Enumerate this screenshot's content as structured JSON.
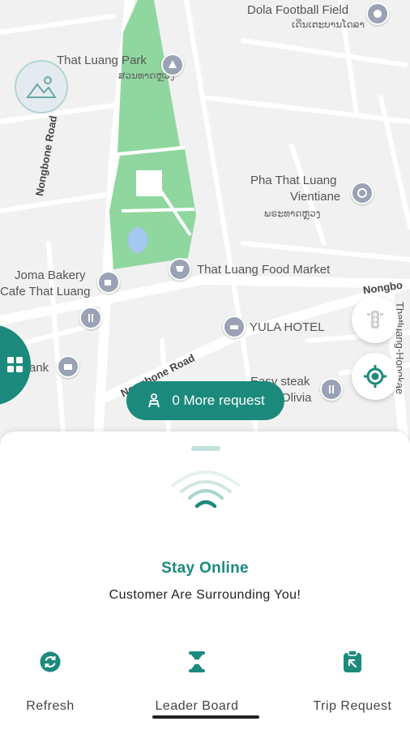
{
  "map": {
    "labels": {
      "dola": "Dola Football Field",
      "dola_lao": "ເດີ່ນເຕະບານໂດລາ",
      "that_luang_park": "That Luang Park",
      "that_luang_park_lao": "ສວນທາດຫຼວງ",
      "nongbone_road_v": "Nongbone Road",
      "pha_that_luang": "Pha That Luang",
      "vientiane": "Vientiane",
      "pha_lao": "ພຣະທາດຫຼວງ",
      "joma": "Joma Bakery",
      "cafe": "Cafe That Luang",
      "food_market": "That Luang Food Market",
      "nongbo": "Nongbo",
      "yula": "YULA HOTEL",
      "bank": "ank",
      "nongbone_road_d": "Nongbone Road",
      "easy_steak": "Easy steak",
      "olivia": "Olivia",
      "thatluang_hongkae": "Thatluang-Hongkae"
    }
  },
  "more_request": {
    "label": "0 More request"
  },
  "sheet": {
    "title": "Stay Online",
    "subtitle": "Customer Are Surrounding You!"
  },
  "nav": {
    "refresh": "Refresh",
    "leader_board": "Leader Board",
    "trip_request": "Trip Request"
  },
  "colors": {
    "accent": "#1b8a7d",
    "park": "#8fd79f"
  }
}
